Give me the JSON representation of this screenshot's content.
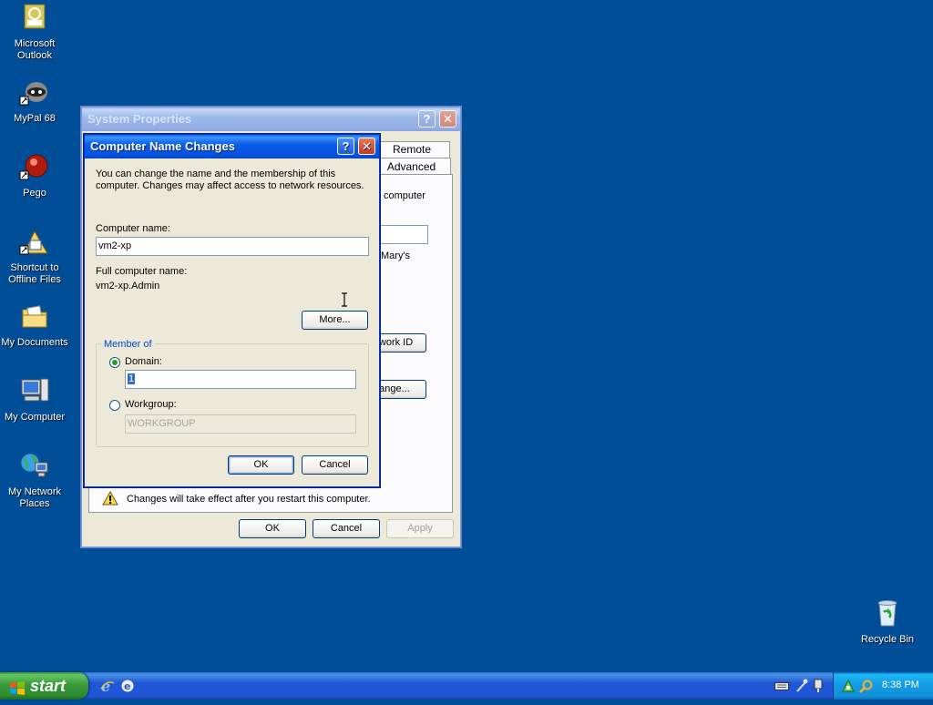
{
  "desktop": {
    "icons": [
      {
        "label": "Microsoft Outlook"
      },
      {
        "label": "MyPal 68"
      },
      {
        "label": "Pego"
      },
      {
        "label": "Shortcut to Offline Files"
      },
      {
        "label": "My Documents"
      },
      {
        "label": "My Computer"
      },
      {
        "label": "My Network Places"
      },
      {
        "label": "Recycle Bin"
      }
    ]
  },
  "system_properties": {
    "title": "System Properties",
    "tabs": [
      "Remote",
      "Advanced"
    ],
    "partial_text": [
      "computer",
      "Mary's"
    ],
    "network_id_button": "twork ID",
    "change_button": "ange...",
    "warning": "Changes will take effect after you restart this computer.",
    "ok": "OK",
    "cancel": "Cancel",
    "apply": "Apply"
  },
  "dialog": {
    "title": "Computer Name Changes",
    "description": "You can change the name and the membership of this computer. Changes may affect access to network resources.",
    "computer_name_label": "Computer name:",
    "computer_name_value": "vm2-xp",
    "full_name_label": "Full computer name:",
    "full_name_value": "vm2-xp.Admin",
    "more_button": "More...",
    "member_of_label": "Member of",
    "domain_label": "Domain:",
    "domain_value": "1",
    "workgroup_label": "Workgroup:",
    "workgroup_value": "WORKGROUP",
    "selected_membership": "Domain",
    "ok": "OK",
    "cancel": "Cancel"
  },
  "taskbar": {
    "start_label": "start",
    "clock": "8:38 PM"
  },
  "colors": {
    "desktop": "#004e98",
    "title_active": "#0a5ee8",
    "dialog_face": "#ece9d8",
    "start_green": "#3a9a3a"
  }
}
